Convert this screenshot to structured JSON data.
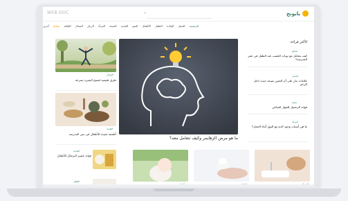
{
  "header": {
    "logo_text": "بابونج",
    "partner_text": "WEB-DOC",
    "search_placeholder": ""
  },
  "nav": {
    "items": [
      "الرئيسية",
      "الحمل",
      "الولادة",
      "الطفل",
      "الأطفال",
      "النمو",
      "التغذية",
      "الصحة",
      "المرأة",
      "الرجل",
      "الجمال",
      "اللياقة",
      "نصائح",
      "أخرى"
    ]
  },
  "hero": {
    "caption": "ما هو مرض الزهايمر وكيف نتعامل معه؟"
  },
  "sidebar": {
    "title": "الأكثر قراءة",
    "items": [
      {
        "category": "نصائح",
        "text": "كيف تتعامل مع نوبات الغضب عند الطفل في عمر المدرسة؟"
      },
      {
        "category": "الحمل",
        "text": "علامات تدل على أن الجنين بصحة جيدة داخل الرحم"
      },
      {
        "category": "صحة",
        "text": "فوائد الزنجبيل للجهاز المناعي"
      },
      {
        "category": "المرأة",
        "text": "ما هي أسباب وجود الدم مع البول أثناء الحمل؟"
      }
    ]
  },
  "left_cards": [
    {
      "category": "الجمال",
      "text": "طرق طبيعية لتفتيح البشرة بسرعة"
    },
    {
      "category": "التغذية",
      "text": "أطعمة مفيدة للأطفال في سن المدرسة"
    }
  ],
  "bottom_row": [
    {
      "category": "الطفل",
      "text": "كيف تحافظين على بشرة طفلك؟"
    },
    {
      "category": "الحمل",
      "text": "نصائح للحامل في الشهر التاسع"
    },
    {
      "category": "العناية",
      "text": "فوائد الكريمات المرطبة للجلد"
    },
    {
      "category": "الجمال",
      "text": "أسباب جفاف البشرة في الصيف"
    }
  ],
  "left_bottom": [
    {
      "category": "التغذية",
      "text": "فوائد عصير البرتقال للأطفال"
    },
    {
      "category": "الطفل",
      "text": "متى يبدأ الطفل بالمشي؟"
    }
  ],
  "colors": {
    "brand_green": "#2f7a5d",
    "accent_orange": "#ff9900",
    "logo_dot": "#f4b400",
    "hero_bg": "#3f4550"
  }
}
